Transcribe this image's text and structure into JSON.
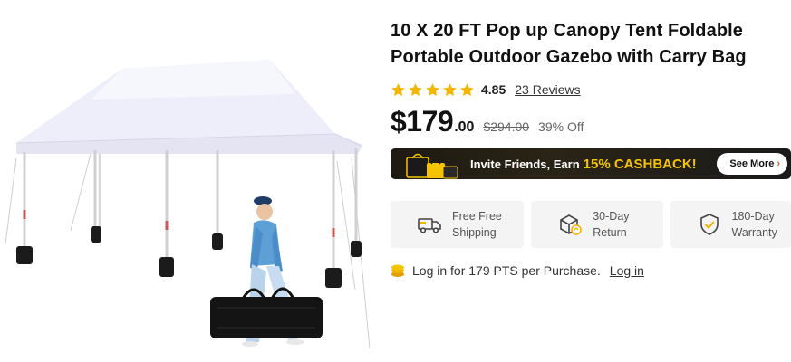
{
  "product": {
    "title": "10 X 20 FT Pop up Canopy Tent Foldable Portable Outdoor Gazebo with Carry Bag",
    "image_alt": "White pop up canopy tent with man carrying black bag"
  },
  "rating": {
    "stars": 5,
    "value": "4.85",
    "reviews_label": "23 Reviews"
  },
  "price": {
    "main": "$179",
    "cents": ".00",
    "original": "$294.00",
    "discount": "39% Off"
  },
  "promo_banner": {
    "text": "Invite Friends, Earn",
    "highlight": "15% CASHBACK!",
    "button_label": "See More",
    "button_chevron": "›"
  },
  "features": [
    {
      "icon": "truck-icon",
      "line1": "Free Free",
      "line2": "Shipping"
    },
    {
      "icon": "return-box-icon",
      "line1": "30-Day",
      "line2": "Return"
    },
    {
      "icon": "shield-check-icon",
      "line1": "180-Day",
      "line2": "Warranty"
    }
  ],
  "points": {
    "icon": "coin-stack-icon",
    "text": "Log in for 179 PTS per Purchase.",
    "link_label": "Log in"
  },
  "colors": {
    "star": "#f5b400",
    "banner_highlight": "#f5c400",
    "coin": "#f5b400"
  }
}
